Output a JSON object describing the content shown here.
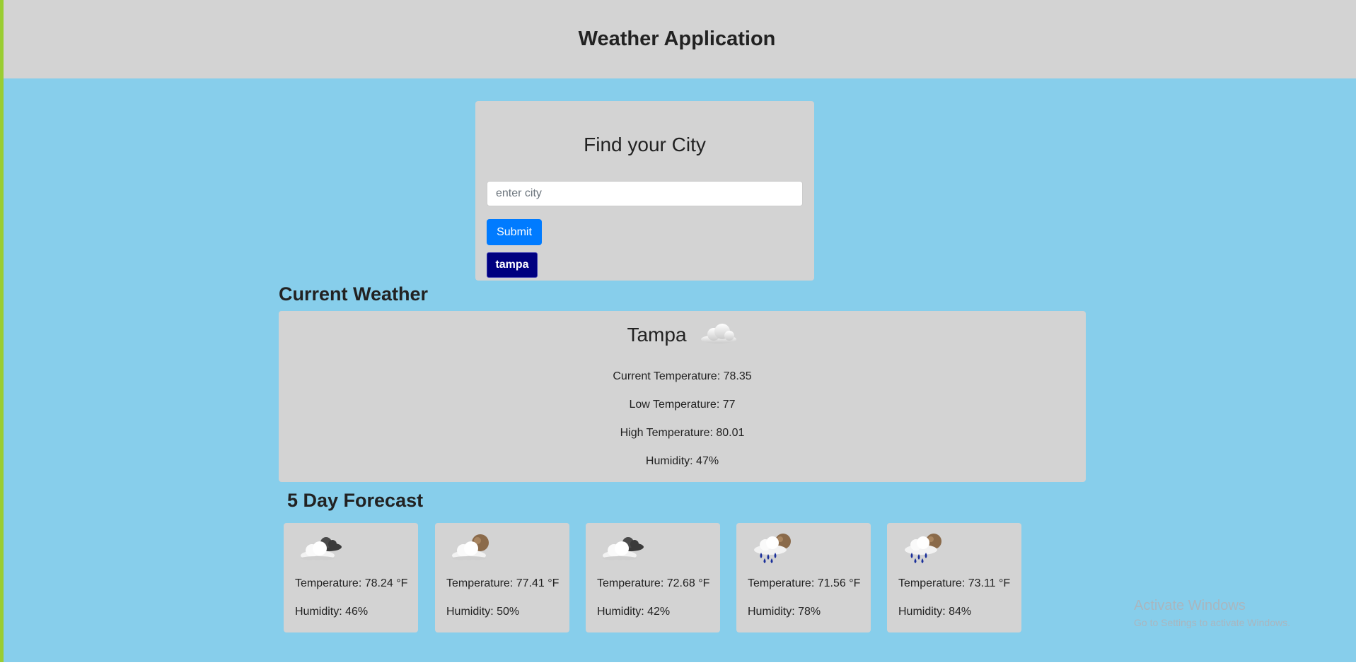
{
  "header": {
    "title": "Weather Application"
  },
  "search": {
    "heading": "Find your City",
    "placeholder": "enter city",
    "submit_label": "Submit",
    "history": [
      "tampa"
    ]
  },
  "current": {
    "section_title": "Current Weather",
    "city": "Tampa",
    "icon": "cloud-icon",
    "temperature": "Current Temperature: 78.35",
    "low": "Low Temperature: 77",
    "high": "High Temperature: 80.01",
    "humidity": "Humidity: 47%"
  },
  "forecast": {
    "section_title": "5 Day Forecast",
    "days": [
      {
        "icon": "broken-clouds-icon",
        "temperature": "Temperature: 78.24 °F",
        "humidity": "Humidity: 46%"
      },
      {
        "icon": "partly-cloudy-night-icon",
        "temperature": "Temperature: 77.41 °F",
        "humidity": "Humidity: 50%"
      },
      {
        "icon": "broken-clouds-icon",
        "temperature": "Temperature: 72.68 °F",
        "humidity": "Humidity: 42%"
      },
      {
        "icon": "rain-night-icon",
        "temperature": "Temperature: 71.56 °F",
        "humidity": "Humidity: 78%"
      },
      {
        "icon": "rain-night-icon",
        "temperature": "Temperature: 73.11 °F",
        "humidity": "Humidity: 84%"
      }
    ]
  },
  "watermark": {
    "line1": "Activate Windows",
    "line2": "Go to Settings to activate Windows."
  },
  "colors": {
    "page_bg": "#87ceeb",
    "panel_bg": "#d3d3d3",
    "submit_bg": "#007bff",
    "history_bg": "#000080",
    "left_accent": "#9acd32"
  }
}
